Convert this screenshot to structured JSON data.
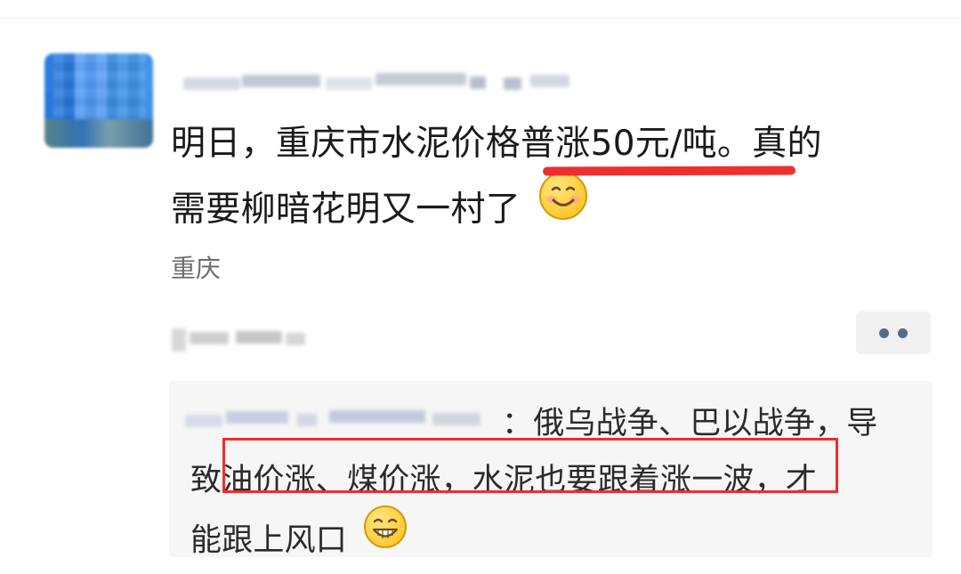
{
  "post": {
    "text_line_1_segment_1": "明日，重庆市水泥价格普涨50元/吨。真的",
    "text_line_2_segment_1": "需要柳暗花明又一村了",
    "smile_emoji": "smile-face-icon",
    "location": "重庆"
  },
  "comment": {
    "line_1_suffix": "：俄乌战争、巴以战争，导",
    "line_2": "致油价涨、煤价涨，水泥也要跟着涨一波，才",
    "line_3": "能跟上风口",
    "grin_emoji": "grin-face-icon"
  },
  "colors": {
    "accent_red": "#ef2f2f",
    "more_dots": "#596b8a",
    "comment_bg": "#f6f6f6"
  }
}
